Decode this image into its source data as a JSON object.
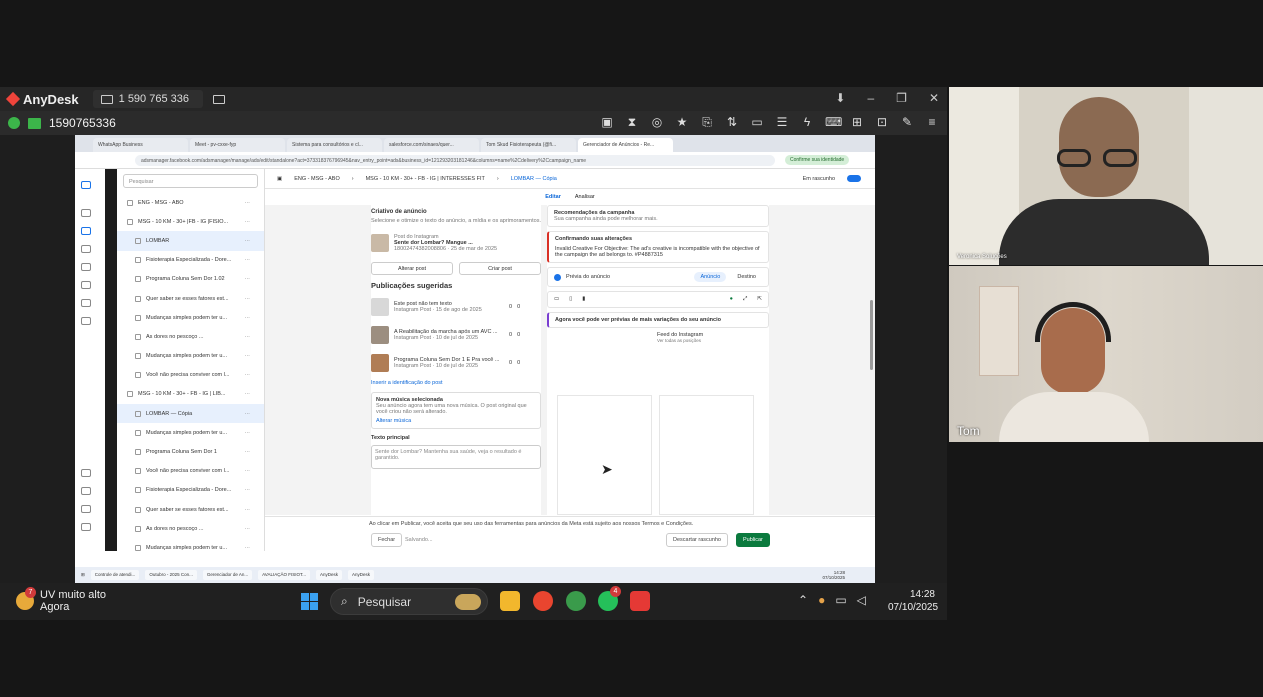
{
  "anydesk": {
    "app_name": "AnyDesk",
    "session_id": "1 590 765 336",
    "address": "1590765336"
  },
  "browser": {
    "tabs": [
      "WhatsApp Business",
      "Meet - pv-cxxe-fyp",
      "Sistema para consultórios e cl...",
      "salesforce.com/sinaes/quer...",
      "Tom Skud Fisioterapeuta (@fi...",
      "Gerenciador de Anúncios - Re..."
    ],
    "url": "adsmanager.facebook.com/adsmanager/manage/ads/edit/standalone?act=373318376796945&nav_entry_point=ads&business_id=121293203181246&columns=name%2Cdelivery%2Ccampaign_name",
    "badge": "Confirme sua identidade"
  },
  "tree": {
    "search_placeholder": "Pesquisar",
    "rows": [
      {
        "label": "ENG - MSG - ABO",
        "level": 0,
        "selected": false
      },
      {
        "label": "MSG - 10 KM - 30+ |FB - IG |FISIO...",
        "level": 0,
        "selected": false
      },
      {
        "label": "LOMBAR",
        "level": 1,
        "selected": true
      },
      {
        "label": "Fisioterapia Especializada - Dore...",
        "level": 1,
        "selected": false
      },
      {
        "label": "Programa Coluna Sem Dor 1.02",
        "level": 1,
        "selected": false
      },
      {
        "label": "Quer saber se esses fatores est...",
        "level": 1,
        "selected": false
      },
      {
        "label": "Mudanças simples podem ter u...",
        "level": 1,
        "selected": false
      },
      {
        "label": "As dores no pescoço ...",
        "level": 1,
        "selected": false
      },
      {
        "label": "Mudanças simples podem ter u...",
        "level": 1,
        "selected": false
      },
      {
        "label": "Você não precisa conviver com l...",
        "level": 1,
        "selected": false
      },
      {
        "label": "MSG - 10 KM - 30+ - FB - IG | LIB...",
        "level": 0,
        "selected": false
      },
      {
        "label": "LOMBAR — Cópia",
        "level": 1,
        "selected": true
      },
      {
        "label": "Mudanças simples podem ter u...",
        "level": 1,
        "selected": false
      },
      {
        "label": "Programa Coluna Sem Dor 1",
        "level": 1,
        "selected": false
      },
      {
        "label": "Você não precisa conviver com l...",
        "level": 1,
        "selected": false
      },
      {
        "label": "Fisioterapia Especializada - Dore...",
        "level": 1,
        "selected": false
      },
      {
        "label": "Quer saber se esses fatores est...",
        "level": 1,
        "selected": false
      },
      {
        "label": "As dores no pescoço ...",
        "level": 1,
        "selected": false
      },
      {
        "label": "Mudanças simples podem ter u...",
        "level": 1,
        "selected": false
      }
    ]
  },
  "editor": {
    "breadcrumb": [
      "ENG - MSG - ABO",
      "MSG - 10 KM - 30+ - FB - IG | INTERESSES FIT",
      "LOMBAR — Cópia"
    ],
    "status": "Em rascunho",
    "tab_edit": "Editar",
    "tab_analyze": "Analisar"
  },
  "left_pane": {
    "creative_title": "Criativo de anúncio",
    "creative_desc": "Selecione e otimize o texto do anúncio, a mídia e os aprimoramentos.",
    "post_source": "Post do Instagram",
    "post_title": "Sente dor Lombar? Mangue ...",
    "post_meta": "18002474382008806 · 25 de mar de 2025",
    "btn_change": "Alterar post",
    "btn_create": "Criar post",
    "suggested_title": "Publicações sugeridas",
    "suggested": [
      {
        "title": "Este post não tem texto",
        "meta": "Instagram Post · 15 de ago de 2025"
      },
      {
        "title": "A Reabilitação da marcha após um AVC ...",
        "meta": "Instagram Post · 10 de jul de 2025"
      },
      {
        "title": "Programa Coluna Sem Dor 1 É Pra você ...",
        "meta": "Instagram Post · 10 de jul de 2025"
      }
    ],
    "post_counts": [
      "0",
      "0"
    ],
    "insert_link": "Inserir a identificação do post",
    "music_title": "Nova música selecionada",
    "music_desc": "Seu anúncio agora tem uma nova música. O post original que você criou não será alterado.",
    "music_link": "Alterar música",
    "primary_text_label": "Texto principal",
    "primary_text_value": "Sente dor Lombar? Mantenha sua saúde, veja o resultado é garantido."
  },
  "right_pane": {
    "reco_title": "Recomendações da campanha",
    "reco_desc": "Sua campanha ainda pode melhorar mais.",
    "confirm_title": "Confirmando suas alterações",
    "confirm_error": "Invalid Creative For Objective: The ad's creative is incompatible with the objective of the campaign the ad belongs to. #P4887315",
    "preview_label": "Prévia do anúncio",
    "preview_tab_ad": "Anúncio",
    "preview_tab_dest": "Destino",
    "variations_note": "Agora você pode ver prévias de mais variações do seu anúncio",
    "feed_label": "Feed do Instagram",
    "feed_sub": "Ver todas as posições"
  },
  "footer": {
    "note": "Ao clicar em Publicar, você aceita que seu uso das ferramentas para anúncios da Meta está sujeito aos nossos Termos e Condições.",
    "close": "Fechar",
    "saving": "Salvando...",
    "discard": "Descartar rascunho",
    "publish": "Publicar"
  },
  "remote_taskbar": {
    "items": [
      "Controle de atendi...",
      "Outubro - 2025 Con...",
      "Gerenciador de An...",
      "AVALIAÇÃO FISIOT...",
      "AnyDesk",
      "AnyDesk"
    ],
    "time": "14:28",
    "date": "07/10/2025"
  },
  "taskbar": {
    "weather_title": "UV muito alto",
    "weather_sub": "Agora",
    "weather_badge": "7",
    "search_label": "Pesquisar",
    "whatsapp_badge": "4",
    "time": "14:28",
    "date": "07/10/2025"
  },
  "video": {
    "participant1": "Veronica Soluções",
    "participant2": "Tom"
  }
}
